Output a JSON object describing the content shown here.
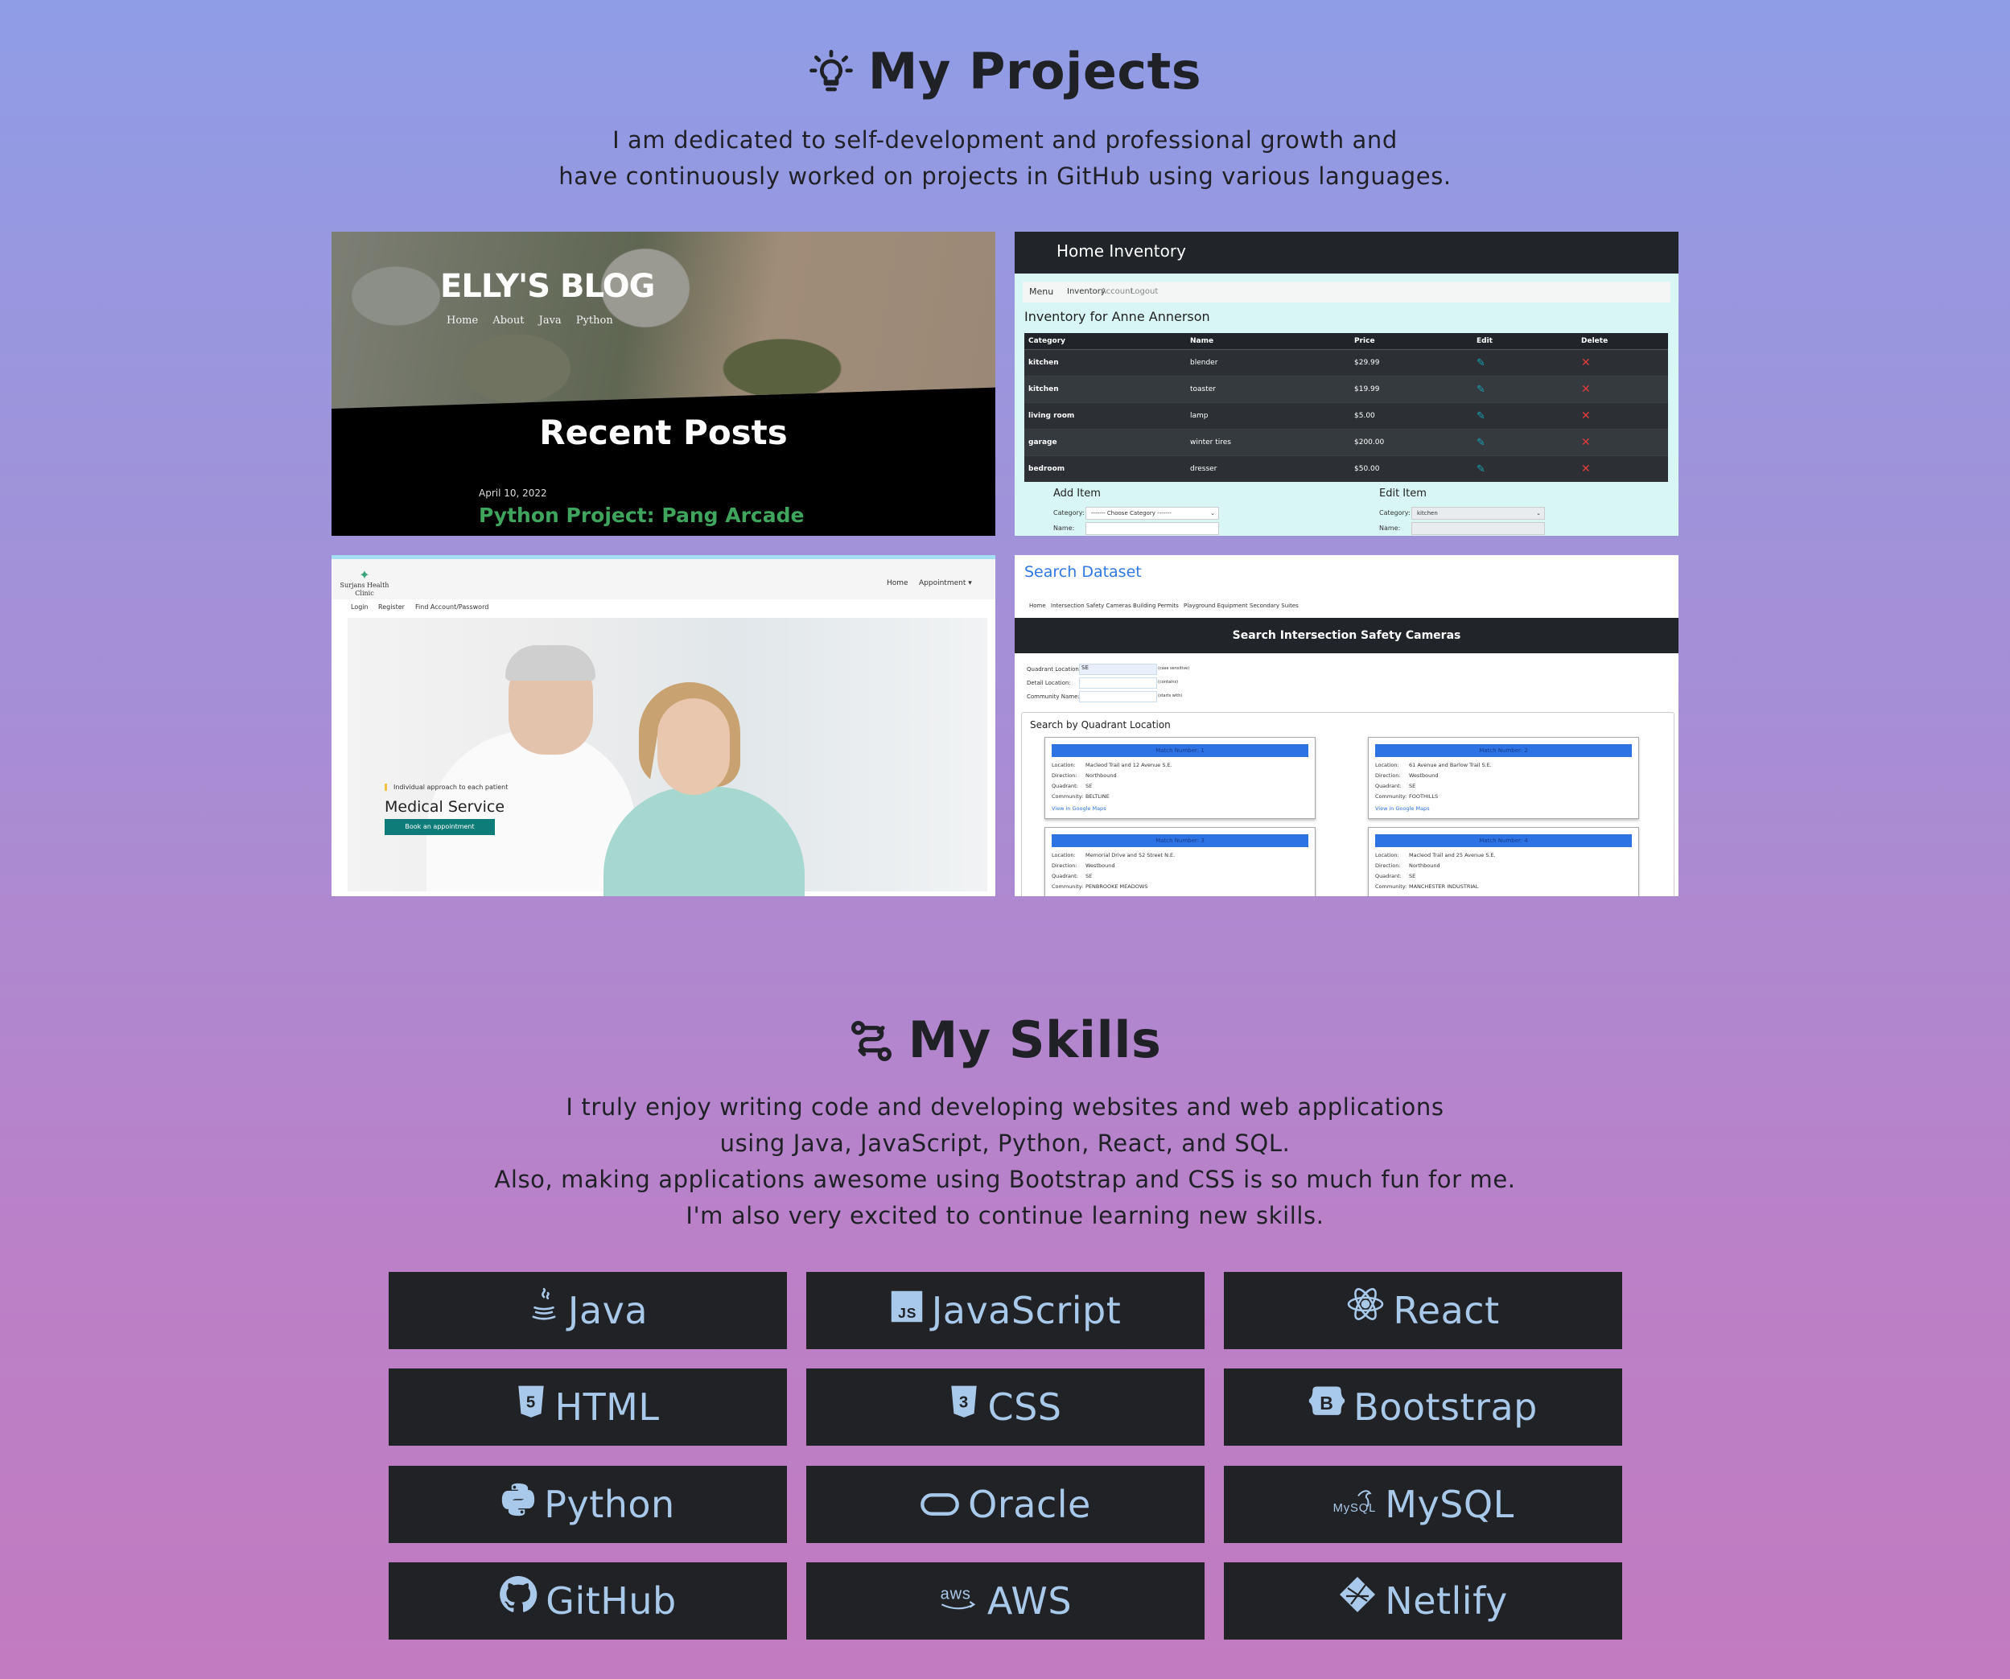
{
  "projects": {
    "title": "My Projects",
    "icon": "lightbulb-icon",
    "intro": [
      "I am dedicated to self-development and professional growth and",
      "have continuously worked on projects in GitHub using various languages."
    ],
    "blog": {
      "title": "ELLY'S BLOG",
      "nav": [
        "Home",
        "About",
        "Java",
        "Python"
      ],
      "section": "Recent Posts",
      "post_date": "April 10, 2022",
      "post_title": "Python Project: Pang Arcade"
    },
    "inventory": {
      "brand": "Home Inventory",
      "menu": [
        "Menu",
        "Inventory",
        "Account",
        "Logout"
      ],
      "heading": "Inventory for Anne Annerson",
      "columns": [
        "Category",
        "Name",
        "Price",
        "Edit",
        "Delete"
      ],
      "rows": [
        [
          "kitchen",
          "blender",
          "$29.99"
        ],
        [
          "kitchen",
          "toaster",
          "$19.99"
        ],
        [
          "living room",
          "lamp",
          "$5.00"
        ],
        [
          "garage",
          "winter tires",
          "$200.00"
        ],
        [
          "bedroom",
          "dresser",
          "$50.00"
        ]
      ],
      "add_item": "Add Item",
      "edit_item": "Edit Item",
      "category_label": "Category:",
      "name_label": "Name:",
      "choose_category": "------- Choose Category -------",
      "edit_category_value": "kitchen"
    },
    "clinic": {
      "logo": "Surjans Health Clinic",
      "nav": [
        "Home",
        "Appointment ▾"
      ],
      "subnav": [
        "Login",
        "Register",
        "Find Account/Password"
      ],
      "tagline": "Individual approach to each patient",
      "title": "Medical Service",
      "button": "Book an appointment"
    },
    "dataset": {
      "title": "Search Dataset",
      "nav": [
        "Home",
        "Intersection Safety Cameras",
        "Building Permits",
        "Playground Equipment",
        "Secondary Suites"
      ],
      "bar": "Search Intersection Safety Cameras",
      "fields": [
        {
          "label": "Quadrant Location:",
          "value": "SE",
          "hint": "(case sensitive)"
        },
        {
          "label": "Detail Location:",
          "value": "",
          "hint": "(contains)"
        },
        {
          "label": "Community Name:",
          "value": "",
          "hint": "(starts with)"
        }
      ],
      "panel_title": "Search by Quadrant Location",
      "labels": [
        "Location:",
        "Direction:",
        "Quadrant:",
        "Community:"
      ],
      "matches": [
        {
          "header": "Match Number: 1",
          "location": "Macleod Trail and 12 Avenue S.E.",
          "direction": "Northbound",
          "quadrant": "SE",
          "community": "BELTLINE",
          "link": "View in Google Maps"
        },
        {
          "header": "Match Number: 2",
          "location": "61 Avenue and Barlow Trail S.E.",
          "direction": "Westbound",
          "quadrant": "SE",
          "community": "FOOTHILLS",
          "link": "View in Google Maps"
        },
        {
          "header": "Match Number: 3",
          "location": "Memorial Drive and 52 Street N.E.",
          "direction": "Westbound",
          "quadrant": "SE",
          "community": "PENBROOKE MEADOWS",
          "link": ""
        },
        {
          "header": "Match Number: 4",
          "location": "Macleod Trail and 25 Avenue S.E.",
          "direction": "Northbound",
          "quadrant": "SE",
          "community": "MANCHESTER INDUSTRIAL",
          "link": ""
        }
      ]
    }
  },
  "skills": {
    "title": "My Skills",
    "icon": "link-nodes-icon",
    "intro": [
      "I truly enjoy writing code and developing websites and web applications",
      "using Java, JavaScript, Python, React, and SQL.",
      "Also, making applications awesome using Bootstrap and CSS is so much fun for me.",
      "I'm also very excited to continue learning new skills."
    ],
    "items": [
      {
        "label": "Java",
        "icon": "java-icon"
      },
      {
        "label": "JavaScript",
        "icon": "javascript-icon"
      },
      {
        "label": "React",
        "icon": "react-icon"
      },
      {
        "label": "HTML",
        "icon": "html5-icon"
      },
      {
        "label": "CSS",
        "icon": "css3-icon"
      },
      {
        "label": "Bootstrap",
        "icon": "bootstrap-icon"
      },
      {
        "label": "Python",
        "icon": "python-icon"
      },
      {
        "label": "Oracle",
        "icon": "oracle-icon"
      },
      {
        "label": "MySQL",
        "icon": "mysql-icon"
      },
      {
        "label": "GitHub",
        "icon": "github-icon"
      },
      {
        "label": "AWS",
        "icon": "aws-icon"
      },
      {
        "label": "Netlify",
        "icon": "netlify-icon"
      }
    ],
    "icon_text": {
      "javascript": "JS",
      "bootstrap": "B",
      "html": "5",
      "css": "3",
      "mysql": "MySQL",
      "aws": "aws"
    }
  },
  "colors": {
    "gradient_top": "#8f9de6",
    "gradient_bottom": "#c27bbf",
    "skill_bg": "#202226",
    "skill_text": "#a9c9ea",
    "blog_post_title": "#3fa45c",
    "link_blue": "#2f78e5"
  }
}
